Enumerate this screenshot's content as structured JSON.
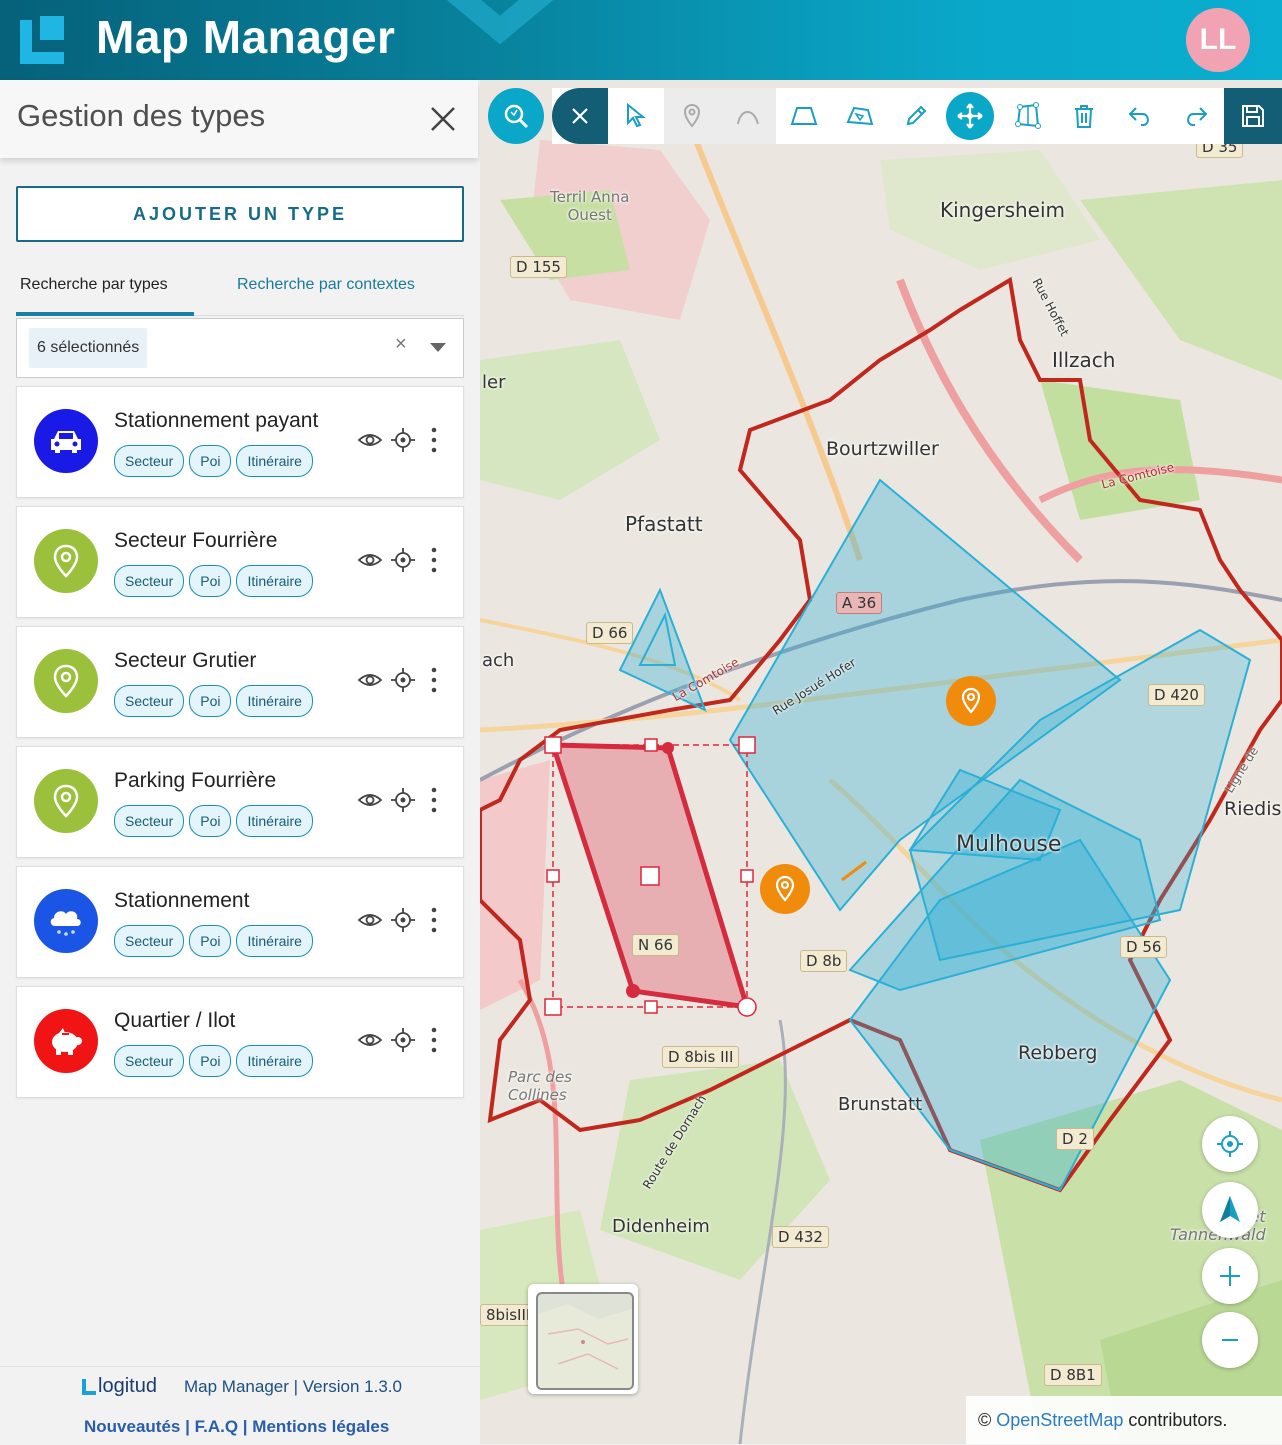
{
  "app": {
    "title": "Map Manager",
    "avatar_initials": "LL",
    "logo_icon": "logitud-l-icon"
  },
  "panel": {
    "title": "Gestion des types",
    "add_button": "AJOUTER UN TYPE",
    "tabs": [
      {
        "label": "Recherche par types",
        "active": true
      },
      {
        "label": "Recherche par contextes",
        "active": false
      }
    ],
    "filter": {
      "selected_text": "6 sélectionnés",
      "clear": "×"
    },
    "types": [
      {
        "name": "Stationnement payant",
        "icon": "car-icon",
        "color": "#1a1ae6",
        "tags": [
          "Secteur",
          "Poi",
          "Itinéraire"
        ]
      },
      {
        "name": "Secteur Fourrière",
        "icon": "map-pin-icon",
        "color": "#9bc03b",
        "tags": [
          "Secteur",
          "Poi",
          "Itinéraire"
        ]
      },
      {
        "name": "Secteur Grutier",
        "icon": "map-pin-icon",
        "color": "#9bc03b",
        "tags": [
          "Secteur",
          "Poi",
          "Itinéraire"
        ]
      },
      {
        "name": "Parking Fourrière",
        "icon": "map-pin-icon",
        "color": "#9bc03b",
        "tags": [
          "Secteur",
          "Poi",
          "Itinéraire"
        ]
      },
      {
        "name": "Stationnement",
        "icon": "snow-cloud-icon",
        "color": "#1a55e6",
        "tags": [
          "Secteur",
          "Poi",
          "Itinéraire"
        ]
      },
      {
        "name": "Quartier / Ilot",
        "icon": "piggy-bank-icon",
        "color": "#f01414",
        "tags": [
          "Secteur",
          "Poi",
          "Itinéraire"
        ]
      }
    ]
  },
  "footer": {
    "brand": "logitud",
    "version_text": "Map Manager | Version 1.3.0",
    "links": [
      "Nouveautés",
      "F.A.Q",
      "Mentions légales"
    ],
    "separator": "|"
  },
  "map": {
    "attribution_prefix": "©",
    "attribution_link": "OpenStreetMap",
    "attribution_suffix": "contributors.",
    "labels": {
      "kingersheim": "Kingersheim",
      "illzach": "Illzach",
      "bourtzwiller": "Bourtzwiller",
      "pfastatt": "Pfastatt",
      "mulhouse": "Mulhouse",
      "rebberg": "Rebberg",
      "brunstatt": "Brunstatt",
      "didenheim": "Didenheim",
      "riedis": "Riedis",
      "terril": "Terril Anna\nOuest",
      "foret": "Forêt\nTannenwald",
      "parc": "Parc des\nCollines",
      "ler": "ler",
      "ach": "ach",
      "rue_hoffet": "Rue Hoffet",
      "rue_josue": "Rue Josué Hofer",
      "route_dornach": "Route de Dornach",
      "la_comtoise": "La Comtoise",
      "la_comtoise2": "La Comtoise",
      "ligne": "Ligne de",
      "d35": "D 35",
      "d155": "D 155",
      "d66": "D 66",
      "a36": "A 36",
      "d420": "D 420",
      "n66": "N 66",
      "d8b": "D 8b",
      "d8bis": "D 8bis III",
      "d56": "D 56",
      "d2": "D 2",
      "d432": "D 432",
      "d8b1": "D 8B1",
      "d8bisiii": "8bisIII"
    },
    "toolbar_tools": [
      "search-map-icon",
      "close-icon",
      "select-cursor-icon",
      "poi-pin-icon",
      "line-draw-icon",
      "polygon-icon",
      "polygon-edit-icon",
      "pencil-icon",
      "move-icon",
      "transform-icon",
      "trash-icon",
      "undo-icon",
      "redo-icon",
      "save-icon"
    ],
    "colors": {
      "accent": "#0aa7c9",
      "dark_accent": "#135e74",
      "boundary": "#c0281d",
      "sector": "#2ab0d6",
      "poi": "#f08b0c"
    }
  }
}
